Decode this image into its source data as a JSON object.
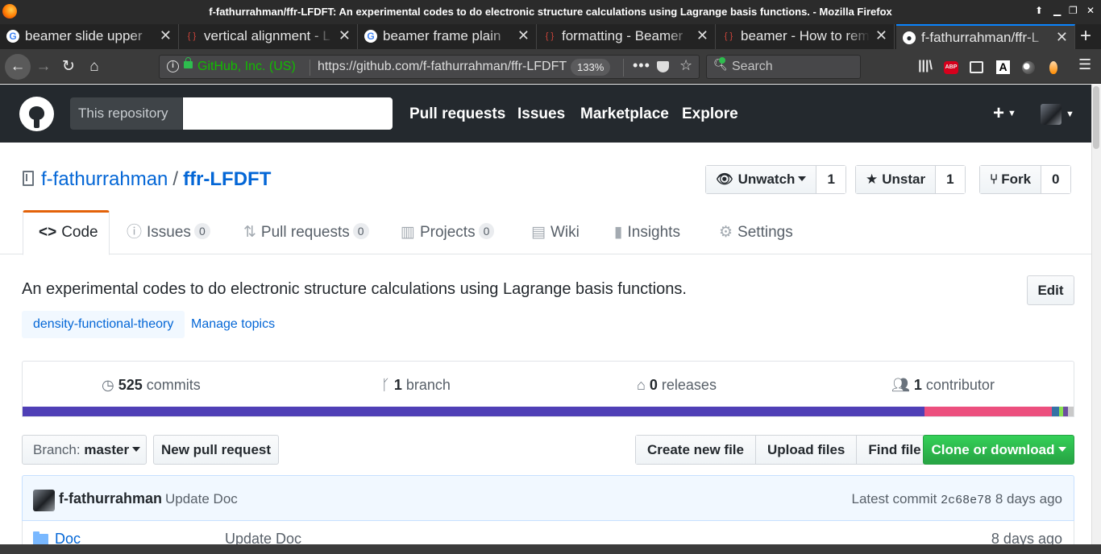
{
  "window": {
    "title": "f-fathurrahman/ffr-LFDFT: An experimental codes to do electronic structure calculations using Lagrange basis functions. - Mozilla Firefox"
  },
  "tabs": [
    {
      "label": "beamer slide upper",
      "icon": "google-icon"
    },
    {
      "label": "vertical alignment - L",
      "icon": "stackexchange-icon"
    },
    {
      "label": "beamer frame plain",
      "icon": "google-icon"
    },
    {
      "label": "formatting - Beamer",
      "icon": "stackexchange-icon"
    },
    {
      "label": "beamer - How to rem",
      "icon": "stackexchange-icon"
    },
    {
      "label": "f-fathurrahman/ffr-L",
      "icon": "github-icon",
      "active": true
    }
  ],
  "navbar": {
    "identity": "GitHub, Inc. (US)",
    "url": "https://github.com/f-fathurrahman/ffr-LFDFT",
    "zoom": "133%",
    "search_placeholder": "Search",
    "more_glyph": "•••"
  },
  "github_header": {
    "scope_label": "This repository",
    "nav": [
      "Pull requests",
      "Issues",
      "Marketplace",
      "Explore"
    ],
    "plus_glyph": "+"
  },
  "repo": {
    "owner": "f-fathurrahman",
    "slash": "/",
    "name": "ffr-LFDFT",
    "watch_label": "Unwatch",
    "watch_count": "1",
    "star_label": "Unstar",
    "star_count": "1",
    "fork_label": "Fork",
    "fork_count": "0"
  },
  "repo_tabs": [
    {
      "label": "Code"
    },
    {
      "label": "Issues",
      "count": "0"
    },
    {
      "label": "Pull requests",
      "count": "0"
    },
    {
      "label": "Projects",
      "count": "0"
    },
    {
      "label": "Wiki"
    },
    {
      "label": "Insights"
    },
    {
      "label": "Settings"
    }
  ],
  "description": "An experimental codes to do electronic structure calculations using Lagrange basis functions.",
  "edit_label": "Edit",
  "topics": [
    "density-functional-theory"
  ],
  "manage_topics": "Manage topics",
  "summary": {
    "commits": {
      "num": "525",
      "label": "commits"
    },
    "branches": {
      "num": "1",
      "label": "branch"
    },
    "releases": {
      "num": "0",
      "label": "releases"
    },
    "contributors": {
      "num": "1",
      "label": "contributor"
    }
  },
  "language_bar": [
    {
      "fraction": 0.858,
      "color": "#4f3fb6"
    },
    {
      "fraction": 0.121,
      "color": "#ec4f7e"
    },
    {
      "fraction": 0.007,
      "color": "#3572a5"
    },
    {
      "fraction": 0.004,
      "color": "#89e051"
    },
    {
      "fraction": 0.005,
      "color": "#6c4fa0"
    },
    {
      "fraction": 0.005,
      "color": "#c9c9c9"
    }
  ],
  "file_nav": {
    "branch_prefix": "Branch:",
    "branch": "master",
    "new_pr": "New pull request",
    "create_file": "Create new file",
    "upload_files": "Upload files",
    "find_file": "Find file",
    "clone": "Clone or download"
  },
  "latest_commit": {
    "author": "f-fathurrahman",
    "message": "Update Doc",
    "prefix": "Latest commit",
    "sha": "2c68e78",
    "age": "8 days ago"
  },
  "files": [
    {
      "name": "Doc",
      "message": "Update Doc",
      "age": "8 days ago"
    }
  ],
  "colors": {
    "header_bg": "#24292e",
    "link": "#0366d6",
    "clone_green": "#28a745",
    "tab_accent": "#e36209"
  }
}
